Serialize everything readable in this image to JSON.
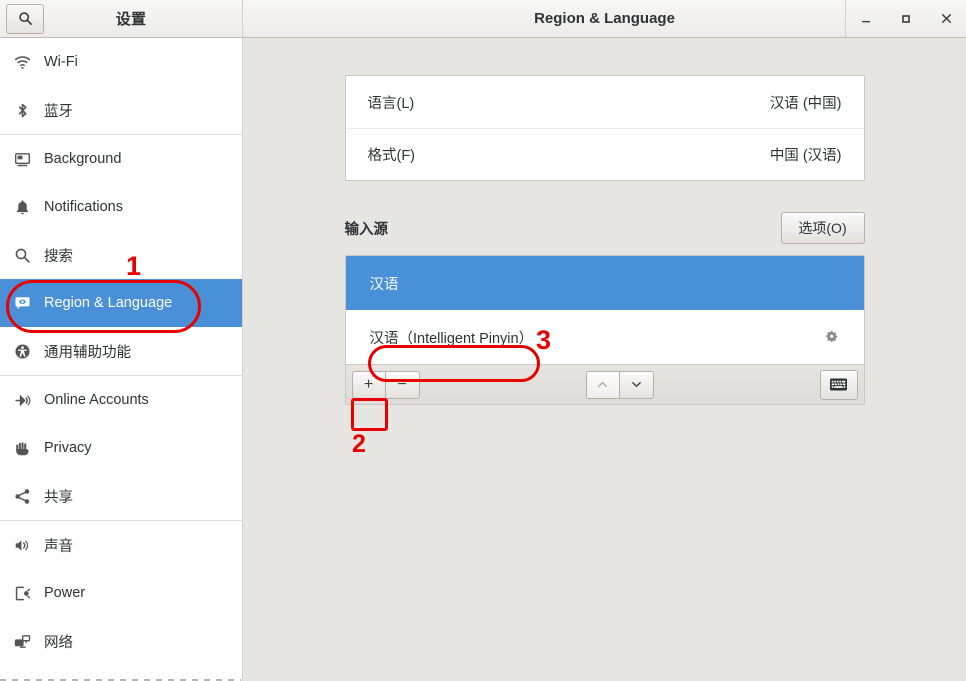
{
  "window": {
    "sidebar_title": "设置",
    "main_title": "Region & Language",
    "search_icon": "search-icon",
    "controls": {
      "minimize": "minimize-icon",
      "maximize": "maximize-icon",
      "close": "close-icon"
    }
  },
  "sidebar": {
    "items": [
      {
        "label": "Wi-Fi",
        "icon": "wifi-icon",
        "selected": false
      },
      {
        "label": "蓝牙",
        "icon": "bluetooth-icon",
        "selected": false
      },
      {
        "label": "Background",
        "icon": "background-icon",
        "selected": false
      },
      {
        "label": "Notifications",
        "icon": "bell-icon",
        "selected": false
      },
      {
        "label": "搜索",
        "icon": "search-icon",
        "selected": false
      },
      {
        "label": "Region & Language",
        "icon": "region-language-icon",
        "selected": true
      },
      {
        "label": "通用辅助功能",
        "icon": "accessibility-icon",
        "selected": false
      },
      {
        "label": "Online Accounts",
        "icon": "online-accounts-icon",
        "selected": false
      },
      {
        "label": "Privacy",
        "icon": "privacy-hand-icon",
        "selected": false
      },
      {
        "label": "共享",
        "icon": "share-icon",
        "selected": false
      },
      {
        "label": "声音",
        "icon": "sound-icon",
        "selected": false
      },
      {
        "label": "Power",
        "icon": "power-icon",
        "selected": false
      },
      {
        "label": "网络",
        "icon": "network-icon",
        "selected": false
      }
    ],
    "separator_after": [
      1,
      6,
      9
    ]
  },
  "main": {
    "language_rows": [
      {
        "key": "语言(L)",
        "value": "汉语 (中国)"
      },
      {
        "key": "格式(F)",
        "value": "中国 (汉语)"
      }
    ],
    "input_sources": {
      "heading": "输入源",
      "options_button": "选项(O)",
      "rows": [
        {
          "label": "汉语",
          "selected": true,
          "has_gear": false
        },
        {
          "label": "汉语（Intelligent Pinyin）",
          "selected": false,
          "has_gear": true
        }
      ],
      "toolbar": {
        "add": "+",
        "remove": "−",
        "move_up": "move-up-icon",
        "move_down": "move-down-icon",
        "keyboard": "keyboard-icon"
      }
    }
  },
  "annotations": {
    "color": "#e60000",
    "markers": [
      {
        "number": "1",
        "target": "sidebar-item-region-language"
      },
      {
        "number": "2",
        "target": "input-source-add-button"
      },
      {
        "number": "3",
        "target": "input-source-row-pinyin"
      }
    ]
  }
}
